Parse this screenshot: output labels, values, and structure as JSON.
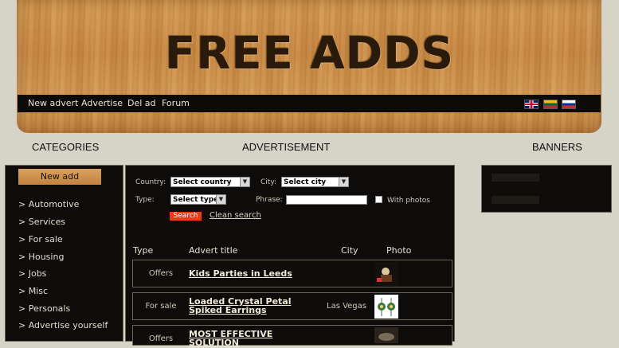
{
  "header": {
    "logo": "FREE ADDS",
    "nav": [
      "New advert",
      "Advertise",
      "Del ad",
      "Forum"
    ],
    "languages": [
      "English",
      "Lithuanian",
      "Russian"
    ]
  },
  "sections": {
    "categories": "CATEGORIES",
    "advertisement": "ADVERTISEMENT",
    "banners": "BANNERS"
  },
  "categories": {
    "new_add_button": "New add",
    "items": [
      "> Automotive",
      "> Services",
      "> For sale",
      "> Housing",
      "> Jobs",
      "> Misc",
      "> Personals",
      "> Advertise yourself"
    ]
  },
  "search": {
    "country_label": "Country:",
    "country_value": "Select country",
    "city_label": "City:",
    "city_value": "Select city",
    "type_label": "Type:",
    "type_value": "Select type",
    "phrase_label": "Phrase:",
    "phrase_value": "",
    "with_photos_label": "With photos",
    "search_button": "Search",
    "clean_link": "Clean search"
  },
  "table": {
    "columns": [
      "Type",
      "Advert title",
      "City",
      "Photo"
    ],
    "rows": [
      {
        "type": "Offers",
        "title": "Kids Parties in Leeds",
        "city": "",
        "photo": "party-photo"
      },
      {
        "type": "For sale",
        "title": "Loaded Crystal Petal Spiked Earrings",
        "city": "Las Vegas",
        "photo": "earrings-photo"
      },
      {
        "type": "Offers",
        "title": "MOST EFFECTIVE SOLUTION",
        "city": "",
        "photo": "dark-photo"
      }
    ]
  },
  "colors": {
    "background": "#d6d4c6",
    "panel": "#0e0c0a",
    "search_button": "#ee3a12",
    "wood": "#c98a45"
  }
}
